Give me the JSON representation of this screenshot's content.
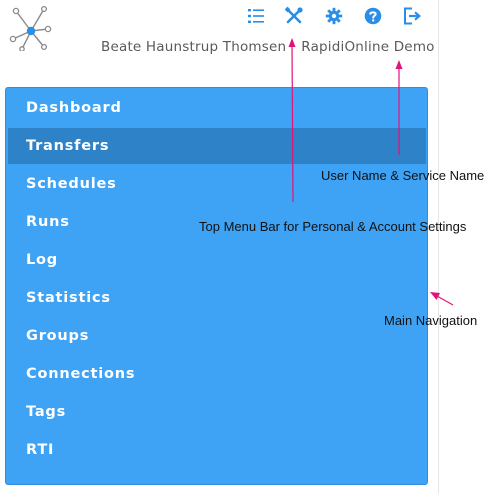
{
  "user_line": {
    "user_name": "Beate Haunstrup Thomsen",
    "service_name": "RapidiOnline Demo"
  },
  "top_menu": [
    {
      "name": "list-icon"
    },
    {
      "name": "tools-icon"
    },
    {
      "name": "gear-icon"
    },
    {
      "name": "help-icon"
    },
    {
      "name": "logout-icon"
    }
  ],
  "nav": {
    "items": [
      {
        "label": "Dashboard",
        "active": false
      },
      {
        "label": "Transfers",
        "active": true
      },
      {
        "label": "Schedules",
        "active": false
      },
      {
        "label": "Runs",
        "active": false
      },
      {
        "label": "Log",
        "active": false
      },
      {
        "label": "Statistics",
        "active": false
      },
      {
        "label": "Groups",
        "active": false
      },
      {
        "label": "Connections",
        "active": false
      },
      {
        "label": "Tags",
        "active": false
      },
      {
        "label": "RTI",
        "active": false
      }
    ]
  },
  "annotations": {
    "user_service": "User Name & Service Name",
    "top_menu": "Top Menu Bar for Personal & Account Settings",
    "main_nav": "Main Navigation"
  },
  "colors": {
    "accent": "#2b8ee6",
    "nav_bg": "#3fa3f5",
    "nav_active": "#2e82c8",
    "arrow": "#e0147a"
  }
}
